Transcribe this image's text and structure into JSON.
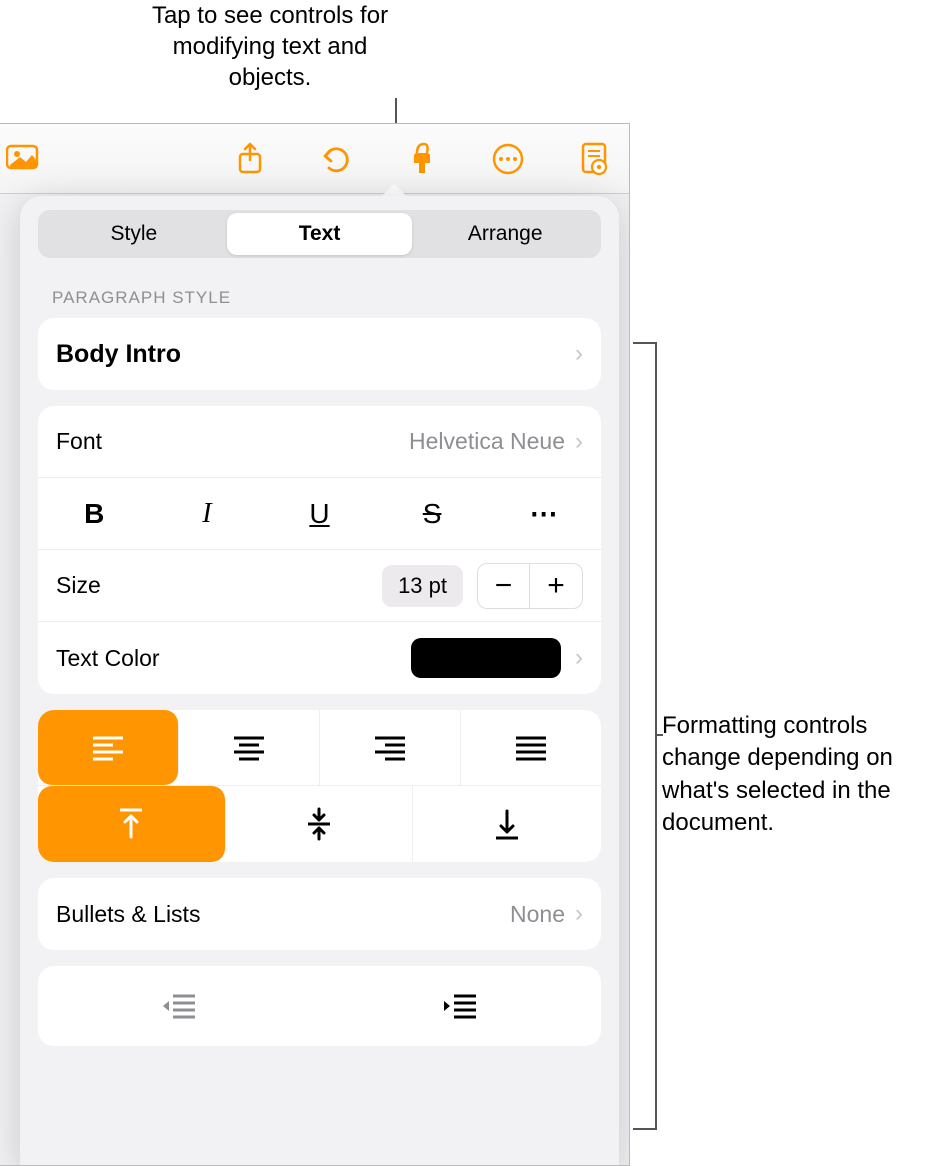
{
  "callouts": {
    "top": "Tap to see controls for modifying text and objects.",
    "right": "Formatting controls change depending on what's selected in the document."
  },
  "toolbar": {
    "icons": [
      "media",
      "share",
      "undo",
      "format-brush",
      "more",
      "document-view"
    ]
  },
  "tabs": {
    "items": [
      "Style",
      "Text",
      "Arrange"
    ],
    "selected_index": 1
  },
  "paragraph_style": {
    "section_label": "PARAGRAPH STYLE",
    "value": "Body Intro"
  },
  "font": {
    "label": "Font",
    "value": "Helvetica Neue"
  },
  "text_styles": {
    "bold": "B",
    "italic": "I",
    "underline": "U",
    "strike": "S",
    "more": "⋯"
  },
  "size": {
    "label": "Size",
    "value": "13 pt"
  },
  "text_color": {
    "label": "Text Color",
    "color": "#000000"
  },
  "alignment": {
    "horizontal": [
      "left",
      "center",
      "right",
      "justify"
    ],
    "horizontal_selected": 0,
    "vertical": [
      "top",
      "middle",
      "bottom"
    ],
    "vertical_selected": 0
  },
  "bullets": {
    "label": "Bullets & Lists",
    "value": "None"
  },
  "indent": {
    "items": [
      "outdent",
      "indent"
    ]
  }
}
